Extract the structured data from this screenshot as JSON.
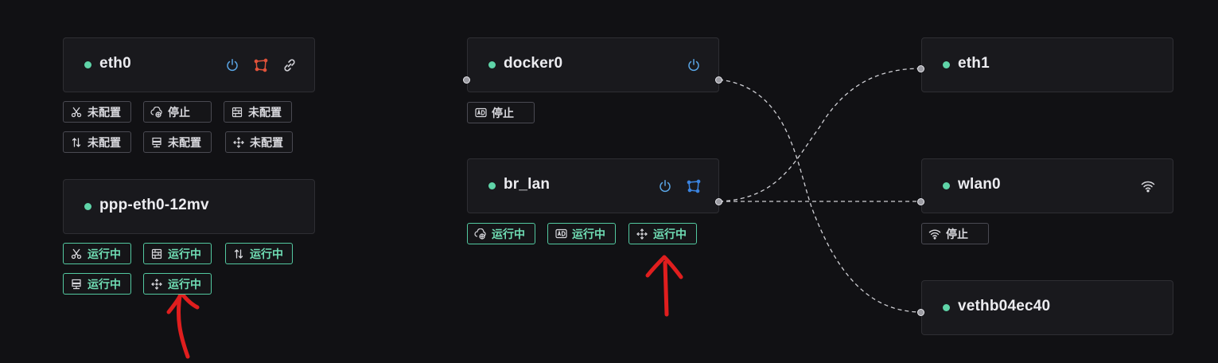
{
  "colors": {
    "background": "#111114",
    "card": "#19191d",
    "status_dot": "#5fd4a8",
    "running": "#6fdcb3",
    "annotation": "#e01e1e",
    "icon_blue": "#5aa6e6",
    "icon_red": "#e0523a"
  },
  "interfaces": {
    "eth0": {
      "name": "eth0",
      "icons": [
        "power-icon",
        "network-icon",
        "link-icon"
      ]
    },
    "ppp": {
      "name": "ppp-eth0-12mv"
    },
    "docker0": {
      "name": "docker0",
      "icons": [
        "power-icon"
      ]
    },
    "br_lan": {
      "name": "br_lan",
      "icons": [
        "power-icon",
        "network-icon"
      ]
    },
    "eth1": {
      "name": "eth1"
    },
    "wlan0": {
      "name": "wlan0",
      "icons": [
        "wifi-icon"
      ]
    },
    "veth": {
      "name": "vethb04ec40"
    }
  },
  "tags": {
    "eth0": [
      {
        "icon": "scissors-icon",
        "label": "未配置"
      },
      {
        "icon": "cloud-globe-icon",
        "label": "停止"
      },
      {
        "icon": "firewall-icon",
        "label": "未配置"
      },
      {
        "icon": "arrows-updown-icon",
        "label": "未配置"
      },
      {
        "icon": "server-icon",
        "label": "未配置"
      },
      {
        "icon": "move-icon",
        "label": "未配置"
      }
    ],
    "ppp": [
      {
        "icon": "scissors-icon",
        "label": "运行中"
      },
      {
        "icon": "firewall-icon",
        "label": "运行中"
      },
      {
        "icon": "arrows-updown-icon",
        "label": "运行中"
      },
      {
        "icon": "server-icon",
        "label": "运行中"
      },
      {
        "icon": "move-icon",
        "label": "运行中"
      }
    ],
    "docker0": [
      {
        "icon": "ad-icon",
        "label": "停止"
      }
    ],
    "br_lan": [
      {
        "icon": "cloud-globe-icon",
        "label": "运行中"
      },
      {
        "icon": "ad-icon",
        "label": "运行中"
      },
      {
        "icon": "move-icon",
        "label": "运行中"
      }
    ],
    "wlan0": [
      {
        "icon": "wifi-icon",
        "label": "停止"
      }
    ]
  }
}
